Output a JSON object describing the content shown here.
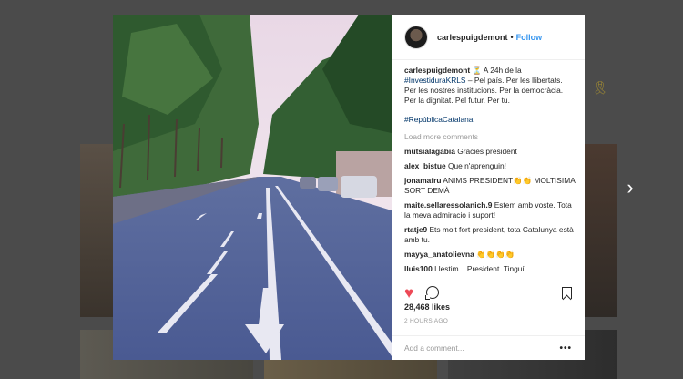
{
  "nav": {
    "next_arrow": "›"
  },
  "post": {
    "username": "carlespuigdemont",
    "dot": "•",
    "follow_label": "Follow",
    "caption": {
      "user": "carlespuigdemont",
      "emoji": "⏳",
      "text_before_tag": "A 24h de la",
      "tag": "#InvestiduraKRLS",
      "text_after_tag": "– Pel país. Per les llibertats. Per les nostres institucions. Per la democràcia. Per la dignitat. Pel futur. Per tu."
    },
    "hashtag": "#RepúblicaCatalana",
    "load_more": "Load more comments",
    "comments": [
      {
        "user": "mutsialagabia",
        "text": "Gràcies president"
      },
      {
        "user": "alex_bistue",
        "text": "Que n'aprenguin!"
      },
      {
        "user": "jonamafru",
        "text": "ANIMS PRESIDENT👏👏 MOLTISIMA SORT DEMÀ"
      },
      {
        "user": "maite.sellaressolanich.9",
        "text": "Estem amb voste. Tota la meva admiracio i suport!"
      },
      {
        "user": "rtatje9",
        "text": "Ets molt fort president, tota Catalunya està amb tu."
      },
      {
        "user": "mayya_anatolievna",
        "text": "👏👏👏👏"
      },
      {
        "user": "lluis100",
        "text": "Llestim... President. Tinguí"
      }
    ],
    "likes": "28,468 likes",
    "time_ago": "2 HOURS AGO",
    "add_comment_placeholder": "Add a comment...",
    "more_options": "•••"
  },
  "colors": {
    "like_red": "#ed4956",
    "link_blue": "#3897f0",
    "tag_blue": "#003569"
  },
  "icons": [
    "heart-icon",
    "comment-icon",
    "bookmark-icon",
    "chevron-right-icon",
    "hourglass-icon"
  ]
}
